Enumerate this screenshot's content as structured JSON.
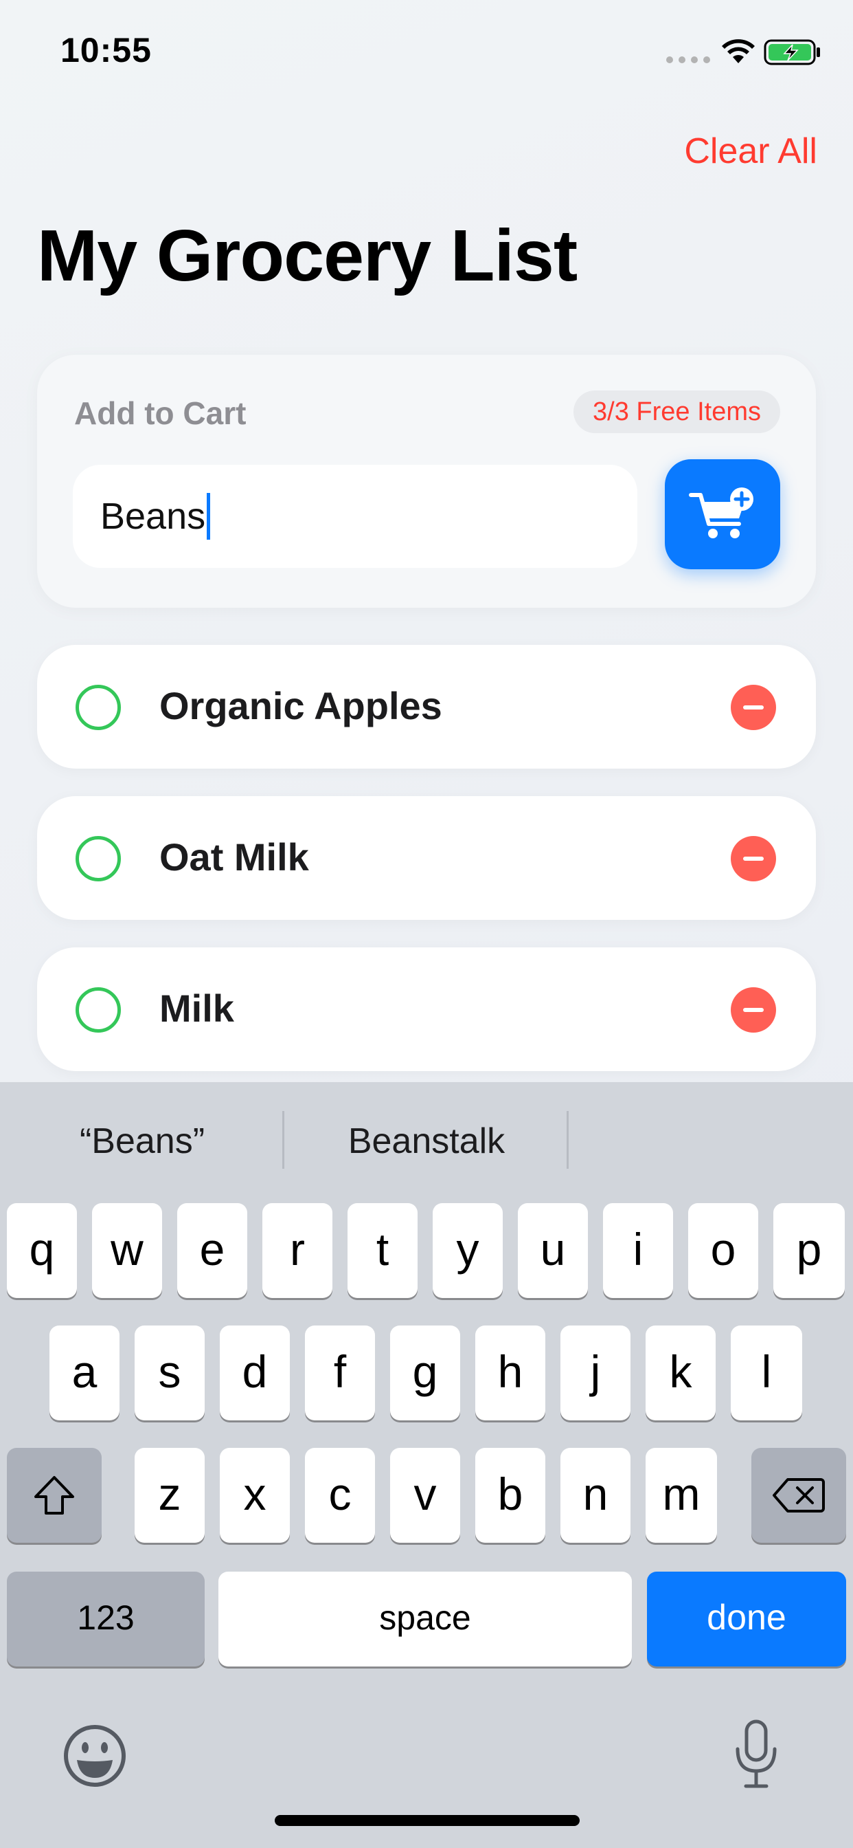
{
  "status": {
    "time": "10:55"
  },
  "header": {
    "clear_all": "Clear All",
    "title": "My Grocery List"
  },
  "add_card": {
    "label": "Add to Cart",
    "badge": "3/3 Free Items",
    "input_value": "Beans"
  },
  "items": [
    {
      "label": "Organic Apples"
    },
    {
      "label": "Oat Milk"
    },
    {
      "label": "Milk"
    }
  ],
  "keyboard": {
    "suggestions": [
      "“Beans”",
      "Beanstalk"
    ],
    "row1": [
      "q",
      "w",
      "e",
      "r",
      "t",
      "y",
      "u",
      "i",
      "o",
      "p"
    ],
    "row2": [
      "a",
      "s",
      "d",
      "f",
      "g",
      "h",
      "j",
      "k",
      "l"
    ],
    "row3": [
      "z",
      "x",
      "c",
      "v",
      "b",
      "n",
      "m"
    ],
    "numbers_key": "123",
    "space_key": "space",
    "done_key": "done"
  },
  "colors": {
    "accent": "#0a7aff",
    "destructive": "#ff3b30",
    "check": "#34c759"
  }
}
